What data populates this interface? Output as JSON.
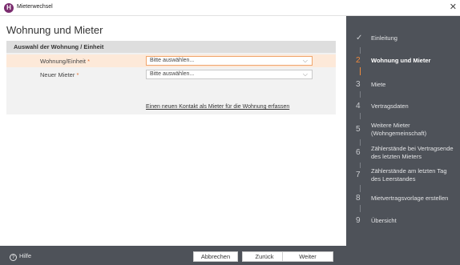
{
  "window": {
    "title": "Mieterwechsel",
    "app_icon_letter": "H"
  },
  "main": {
    "page_title": "Wohnung und Mieter",
    "section_title": "Auswahl der Wohnung / Einheit",
    "rows": [
      {
        "label": "Wohnung/Einheit",
        "required": "*",
        "value": "Bitte auswählen..."
      },
      {
        "label": "Neuer Mieter",
        "required": "*",
        "value": "Bitte auswählen..."
      }
    ],
    "link": "Einen neuen Kontakt als Mieter für die Wohnung erfassen"
  },
  "sidebar": {
    "steps": [
      {
        "num": "✓",
        "label": "Einleitung"
      },
      {
        "num": "2",
        "label": "Wohnung und Mieter"
      },
      {
        "num": "3",
        "label": "Miete"
      },
      {
        "num": "4",
        "label": "Vertragsdaten"
      },
      {
        "num": "5",
        "label": "Weitere Mieter (Wohngemeinschaft)"
      },
      {
        "num": "6",
        "label": "Zählerstände bei Vertragsende des letzten Mieters"
      },
      {
        "num": "7",
        "label": "Zählerstände am letzten Tag des Leerstandes"
      },
      {
        "num": "8",
        "label": "Mietvertragsvorlage erstellen"
      },
      {
        "num": "9",
        "label": "Übersicht"
      }
    ],
    "active_step": 2
  },
  "footer": {
    "help_label": "Hilfe",
    "cancel_label": "Abbrechen",
    "back_label": "Zurück",
    "next_label": "Weiter"
  },
  "colors": {
    "accent": "#f08a3c",
    "sidebar_bg": "#4e5259",
    "highlight_row": "#fde9d9"
  },
  "icons": {
    "close": "close-icon",
    "help": "help-icon",
    "dropdown": "chevron-down-icon",
    "check": "check-icon"
  }
}
